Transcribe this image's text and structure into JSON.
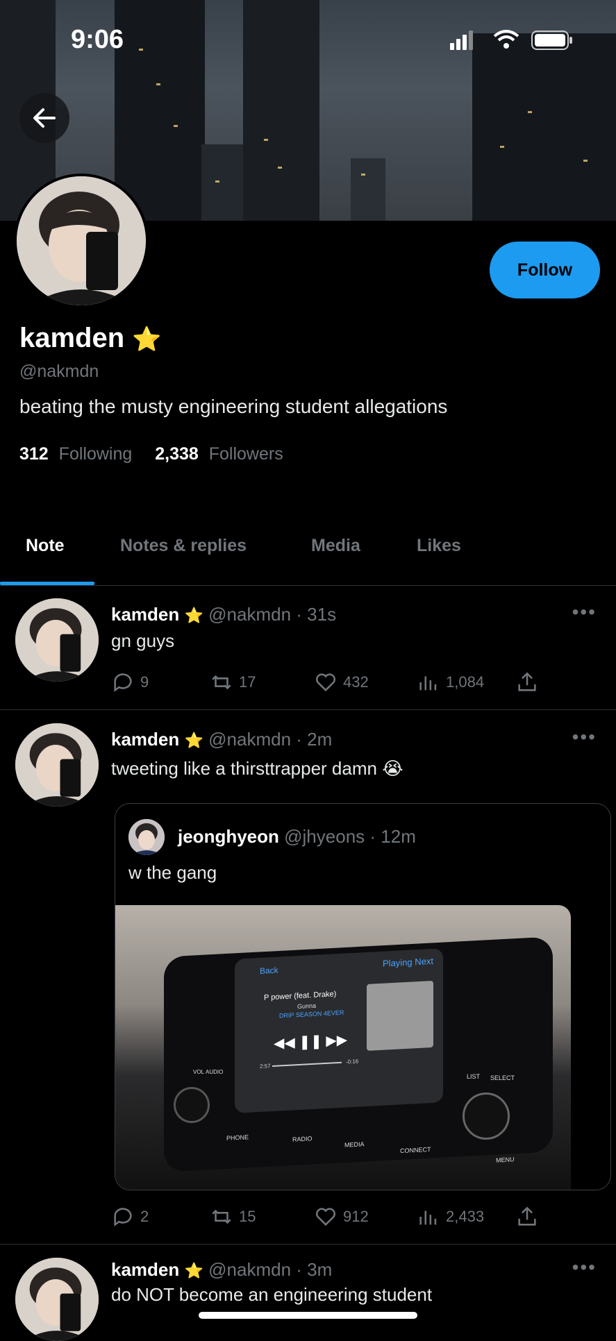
{
  "status_bar": {
    "time": "9:06"
  },
  "profile": {
    "name": "kamden",
    "name_badge": "⭐",
    "handle": "@nakmdn",
    "bio": "beating the musty engineering student allegations",
    "following_count": "312",
    "following_label": "Following",
    "followers_count": "2,338",
    "followers_label": "Followers",
    "follow_button": "Follow"
  },
  "tabs": [
    {
      "label": "Note"
    },
    {
      "label": "Notes & replies"
    },
    {
      "label": "Media"
    },
    {
      "label": "Likes"
    }
  ],
  "posts": [
    {
      "name": "kamden",
      "badge": "⭐",
      "handle": "@nakmdn",
      "time": "· 31s",
      "text": "gn guys",
      "replies": "9",
      "retweets": "17",
      "likes": "432",
      "views": "1,084"
    },
    {
      "name": "kamden",
      "badge": "⭐",
      "handle": "@nakmdn",
      "time": "· 2m",
      "text": "tweeting like a thirsttrapper damn 😭",
      "quote": {
        "name": "jeonghyeon",
        "handle": "@jhyeons",
        "time": "· 12m",
        "text": "w the gang",
        "image_text": {
          "back": "Back",
          "playing_next": "Playing Next",
          "song": "P power (feat. Drake)",
          "artist": "Gunna",
          "album": "DRIP SEASON 4EVER",
          "elapsed": "2:57",
          "remaining": "-0:16",
          "buttons": [
            "PHONE",
            "RADIO",
            "MEDIA",
            "CONNECT",
            "MENU",
            "LIST",
            "SELECT",
            "VOL",
            "AUDIO"
          ]
        }
      },
      "replies": "2",
      "retweets": "15",
      "likes": "912",
      "views": "2,433"
    },
    {
      "name": "kamden",
      "badge": "⭐",
      "handle": "@nakmdn",
      "time": "· 3m",
      "text": "do NOT become an engineering student"
    }
  ],
  "colors": {
    "accent": "#1d9bf0",
    "muted": "#71767b",
    "background": "#000000"
  }
}
